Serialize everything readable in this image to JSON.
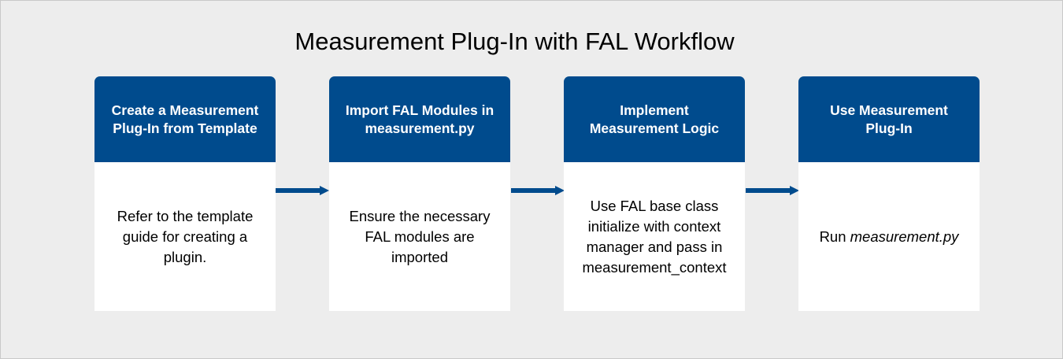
{
  "title": "Measurement Plug-In with FAL Workflow",
  "colors": {
    "header": "#004b8d",
    "arrow": "#004b8d",
    "background": "#ededed"
  },
  "steps": [
    {
      "header": "Create a Measurement\nPlug-In from Template",
      "body": "Refer to the template\nguide for creating a\nplugin."
    },
    {
      "header": "Import FAL Modules in\nmeasurement.py",
      "body": "Ensure the necessary\nFAL modules are\nimported"
    },
    {
      "header": "Implement\nMeasurement Logic",
      "body": "Use FAL base class\ninitialize with context\nmanager and pass in\nmeasurement_context"
    },
    {
      "header": "Use Measurement\nPlug-In",
      "body_prefix": "Run ",
      "body_emphasis": "measurement.py"
    }
  ]
}
